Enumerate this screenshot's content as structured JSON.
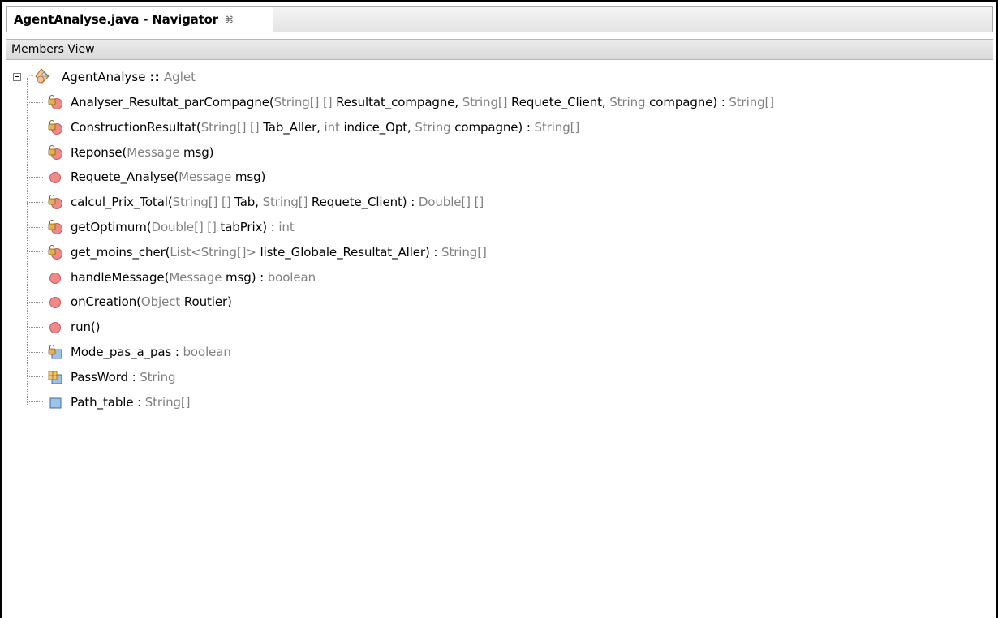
{
  "window": {
    "tab_title": "AgentAnalyse.java - Navigator",
    "tab_close_glyph": "⌘"
  },
  "members_view": {
    "label": "Members View"
  },
  "root": {
    "name": "AgentAnalyse",
    "sep": " :: ",
    "type": "Aglet",
    "icon": "class-icon"
  },
  "members": [
    {
      "icon": "protected-method-icon",
      "parts": [
        [
          "n",
          "Analyser_Resultat_parCompagne("
        ],
        [
          "t",
          "String"
        ],
        [
          "t",
          "[] []"
        ],
        [
          "n",
          " Resultat_compagne, "
        ],
        [
          "t",
          "String"
        ],
        [
          "t",
          "[]"
        ],
        [
          "n",
          " Requete_Client, "
        ],
        [
          "t",
          "String"
        ],
        [
          "n",
          " compagne) : "
        ],
        [
          "t",
          "String[]"
        ]
      ]
    },
    {
      "icon": "protected-method-icon",
      "parts": [
        [
          "n",
          "ConstructionResultat("
        ],
        [
          "t",
          "String"
        ],
        [
          "t",
          "[] []"
        ],
        [
          "n",
          " Tab_Aller, "
        ],
        [
          "t",
          "int"
        ],
        [
          "n",
          " indice_Opt, "
        ],
        [
          "t",
          "String"
        ],
        [
          "n",
          " compagne) : "
        ],
        [
          "t",
          "String[]"
        ]
      ]
    },
    {
      "icon": "protected-method-icon",
      "parts": [
        [
          "n",
          "Reponse("
        ],
        [
          "t",
          "Message"
        ],
        [
          "n",
          " msg)"
        ]
      ]
    },
    {
      "icon": "public-method-icon",
      "parts": [
        [
          "n",
          "Requete_Analyse("
        ],
        [
          "t",
          "Message"
        ],
        [
          "n",
          " msg)"
        ]
      ]
    },
    {
      "icon": "protected-method-icon",
      "parts": [
        [
          "n",
          "calcul_Prix_Total("
        ],
        [
          "t",
          "String"
        ],
        [
          "t",
          "[] []"
        ],
        [
          "n",
          " Tab, "
        ],
        [
          "t",
          "String"
        ],
        [
          "t",
          "[]"
        ],
        [
          "n",
          " Requete_Client) : "
        ],
        [
          "t",
          "Double[] []"
        ]
      ]
    },
    {
      "icon": "protected-method-icon",
      "parts": [
        [
          "n",
          "getOptimum("
        ],
        [
          "t",
          "Double"
        ],
        [
          "t",
          "[] []"
        ],
        [
          "n",
          " tabPrix) : "
        ],
        [
          "t",
          "int"
        ]
      ]
    },
    {
      "icon": "protected-method-icon",
      "parts": [
        [
          "n",
          "get_moins_cher("
        ],
        [
          "t",
          "List<String[]>"
        ],
        [
          "n",
          " liste_Globale_Resultat_Aller) : "
        ],
        [
          "t",
          "String[]"
        ]
      ]
    },
    {
      "icon": "public-method-icon",
      "parts": [
        [
          "n",
          "handleMessage("
        ],
        [
          "t",
          "Message"
        ],
        [
          "n",
          " msg) : "
        ],
        [
          "t",
          "boolean"
        ]
      ]
    },
    {
      "icon": "public-method-icon",
      "parts": [
        [
          "n",
          "onCreation("
        ],
        [
          "t",
          "Object"
        ],
        [
          "n",
          " Routier)"
        ]
      ]
    },
    {
      "icon": "public-method-icon",
      "parts": [
        [
          "n",
          "run()"
        ]
      ]
    },
    {
      "icon": "protected-field-icon",
      "parts": [
        [
          "n",
          "Mode_pas_a_pas : "
        ],
        [
          "t",
          "boolean"
        ]
      ]
    },
    {
      "icon": "package-field-icon",
      "parts": [
        [
          "n",
          "PassWord : "
        ],
        [
          "t",
          "String"
        ]
      ]
    },
    {
      "icon": "public-field-icon",
      "parts": [
        [
          "n",
          "Path_table : "
        ],
        [
          "t",
          "String[]"
        ]
      ]
    }
  ],
  "colors": {
    "type_gray": "#808080",
    "method_pink": "#f08a8a",
    "field_blue": "#9cc3e8"
  }
}
